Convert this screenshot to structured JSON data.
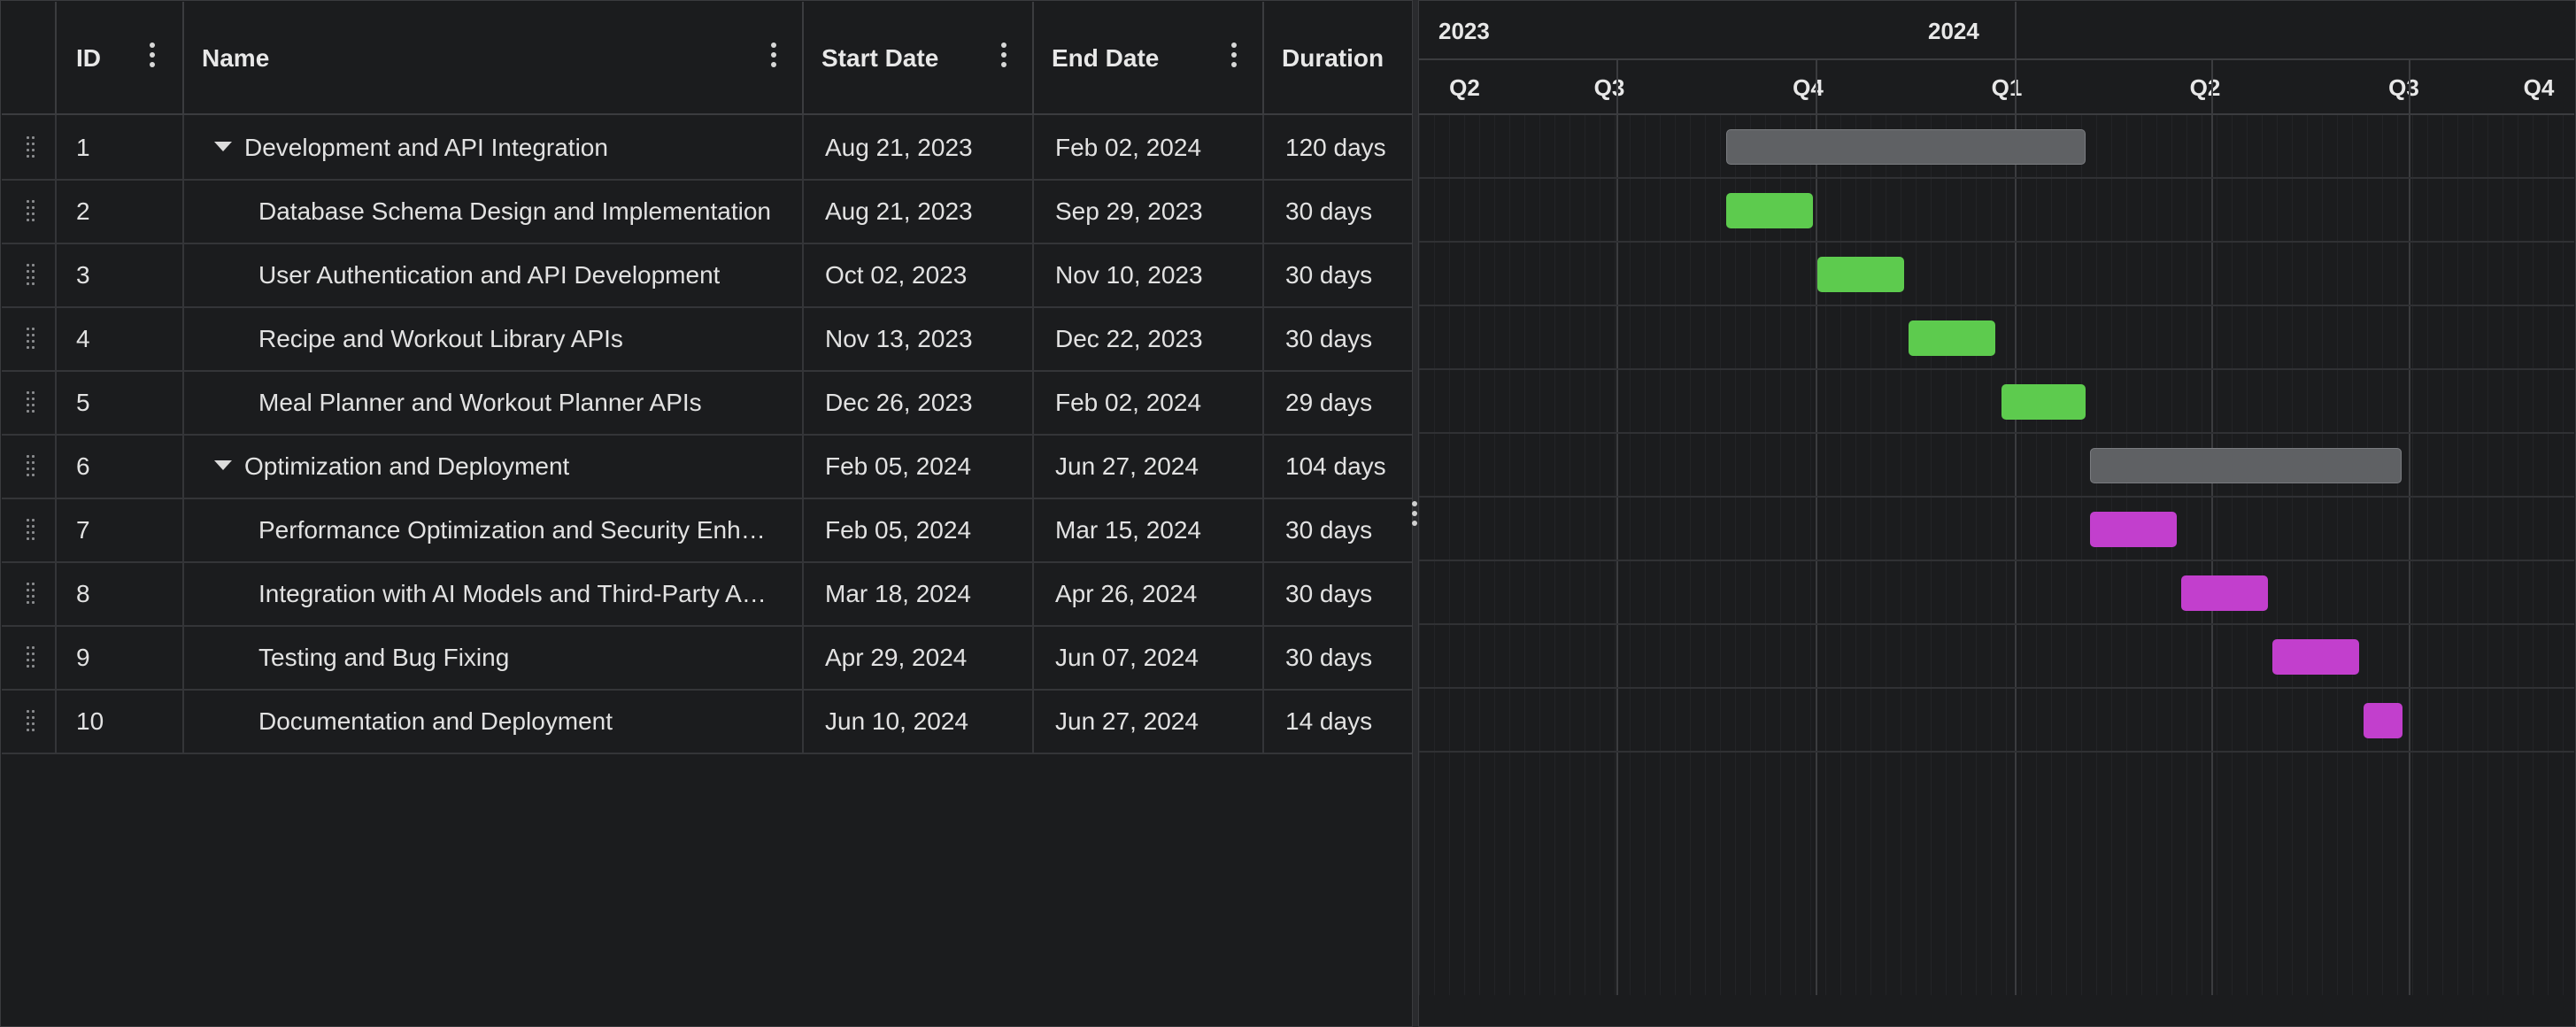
{
  "grid": {
    "columns": [
      {
        "key": "id",
        "label": "ID"
      },
      {
        "key": "name",
        "label": "Name"
      },
      {
        "key": "start",
        "label": "Start Date"
      },
      {
        "key": "end",
        "label": "End Date"
      },
      {
        "key": "duration",
        "label": "Duration"
      }
    ],
    "rows": [
      {
        "id": "1",
        "name": "Development and API Integration",
        "start": "Aug 21, 2023",
        "end": "Feb 02, 2024",
        "duration": "120 days",
        "summary": true,
        "expanded": true
      },
      {
        "id": "2",
        "name": "Database Schema Design and Implementation",
        "start": "Aug 21, 2023",
        "end": "Sep 29, 2023",
        "duration": "30 days"
      },
      {
        "id": "3",
        "name": "User Authentication and API Development",
        "start": "Oct 02, 2023",
        "end": "Nov 10, 2023",
        "duration": "30 days"
      },
      {
        "id": "4",
        "name": "Recipe and Workout Library APIs",
        "start": "Nov 13, 2023",
        "end": "Dec 22, 2023",
        "duration": "30 days"
      },
      {
        "id": "5",
        "name": "Meal Planner and Workout Planner APIs",
        "start": "Dec 26, 2023",
        "end": "Feb 02, 2024",
        "duration": "29 days"
      },
      {
        "id": "6",
        "name": "Optimization and Deployment",
        "start": "Feb 05, 2024",
        "end": "Jun 27, 2024",
        "duration": "104 days",
        "summary": true,
        "expanded": true
      },
      {
        "id": "7",
        "name": "Performance Optimization and Security Enh…",
        "start": "Feb 05, 2024",
        "end": "Mar 15, 2024",
        "duration": "30 days"
      },
      {
        "id": "8",
        "name": "Integration with AI Models and Third-Party A…",
        "start": "Mar 18, 2024",
        "end": "Apr 26, 2024",
        "duration": "30 days"
      },
      {
        "id": "9",
        "name": "Testing and Bug Fixing",
        "start": "Apr 29, 2024",
        "end": "Jun 07, 2024",
        "duration": "30 days"
      },
      {
        "id": "10",
        "name": "Documentation and Deployment",
        "start": "Jun 10, 2024",
        "end": "Jun 27, 2024",
        "duration": "14 days"
      }
    ]
  },
  "timeline": {
    "years": [
      "2023",
      "2024"
    ],
    "quarters": [
      "Q2",
      "Q3",
      "Q4",
      "Q1",
      "Q2",
      "Q3",
      "Q4"
    ]
  },
  "colors": {
    "background": "#1b1c1e",
    "summary_bar": "#5f6164",
    "phase1_bar": "#5dcb4e",
    "phase2_bar": "#c23fcd"
  }
}
